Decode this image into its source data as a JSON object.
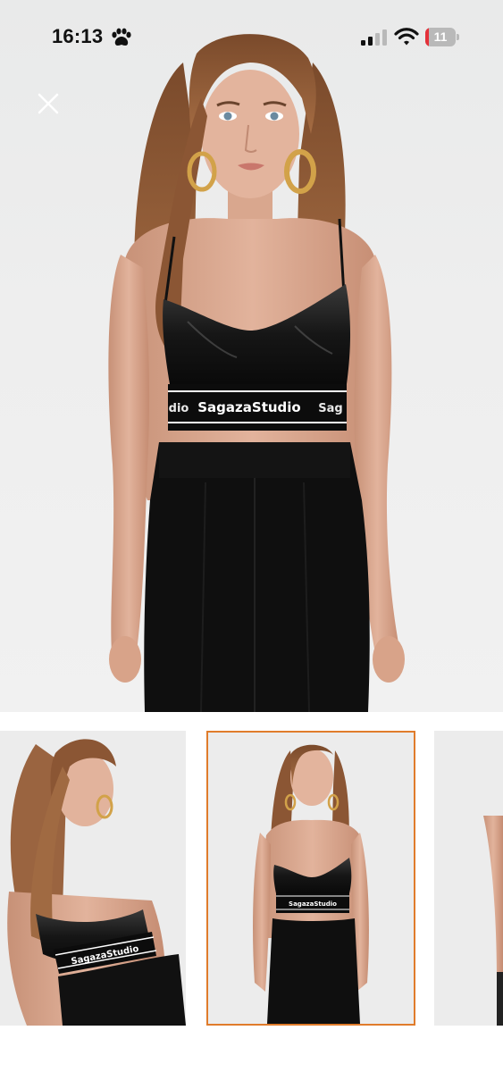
{
  "status_bar": {
    "time": "16:13",
    "battery_level": "11",
    "icons": [
      "paw-icon",
      "signal-icon",
      "wifi-icon",
      "battery-icon"
    ],
    "battery_fill_fraction": 0.11
  },
  "viewer": {
    "close_icon": "close-icon",
    "hero_alt": "Model wearing black faux leather bralette top with logo band and black trousers",
    "brand_band_text": "SagazaStudio",
    "thumbnails": [
      {
        "label": "SagazaStudio",
        "selected": false
      },
      {
        "label": "SagazaStudio",
        "selected": true
      },
      {
        "label": "",
        "selected": false
      }
    ]
  },
  "colors": {
    "selected_thumb_border": "#e07c2b",
    "battery_low": "#e4313a"
  }
}
